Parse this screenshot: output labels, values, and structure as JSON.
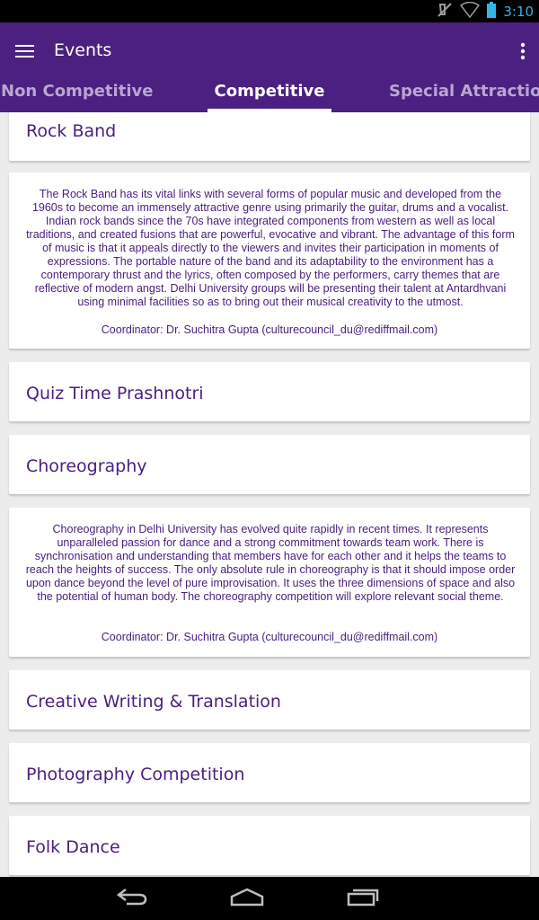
{
  "status_bar": {
    "time": "3:10",
    "icons": [
      "mute-icon",
      "wifi-icon",
      "battery-icon"
    ]
  },
  "app_bar": {
    "title": "Events",
    "menu_icon": "hamburger-menu-icon",
    "overflow_icon": "overflow-menu-icon"
  },
  "tabs": [
    {
      "label": "Non Competitive",
      "selected": false
    },
    {
      "label": "Competitive",
      "selected": true
    },
    {
      "label": "Special Attractions",
      "selected": false
    }
  ],
  "events": [
    {
      "title": "Rock Band",
      "description": "The Rock Band has its vital links with several forms of popular music and developed from the 1960s to become an immensely attractive genre using primarily the guitar, drums and a vocalist. Indian rock bands since the 70s have integrated components from western as well as local traditions, and created fusions that are powerful, evocative and vibrant. The advantage of this form of music is that it appeals directly to the viewers and invites their participation in moments of expressions. The portable nature of the band and its adaptability to the environment has a contemporary thrust and the lyrics, often composed by the performers, carry themes that are reflective of modern angst. Delhi University groups will be presenting their talent at Antardhvani using minimal facilities so as to bring out their musical creativity to the utmost.",
      "coordinator": "Coordinator: Dr. Suchitra Gupta (culturecouncil_du@rediffmail.com)"
    },
    {
      "title": "Quiz Time Prashnotri"
    },
    {
      "title": "Choreography",
      "description": "Choreography in Delhi University has evolved quite rapidly in recent times. It represents unparalleled passion for dance and a strong commitment towards team work. There is synchronisation and understanding that members have for each other and it helps the teams to reach the heights of success. The only absolute rule in choreography is that it should impose order upon dance beyond the level of pure improvisation. It uses the three dimensions of space and also the potential of human body. The choreography competition will explore relevant social theme.",
      "coordinator": "Coordinator: Dr. Suchitra Gupta (culturecouncil_du@rediffmail.com)"
    },
    {
      "title": "Creative Writing & Translation"
    },
    {
      "title": "Photography Competition"
    },
    {
      "title": "Folk Dance"
    }
  ],
  "nav_bar": {
    "icons": [
      "back-icon",
      "home-icon",
      "recent-apps-icon"
    ]
  },
  "colors": {
    "primary": "#4b2080",
    "background": "#ececec",
    "status_time": "#33b5e5"
  }
}
